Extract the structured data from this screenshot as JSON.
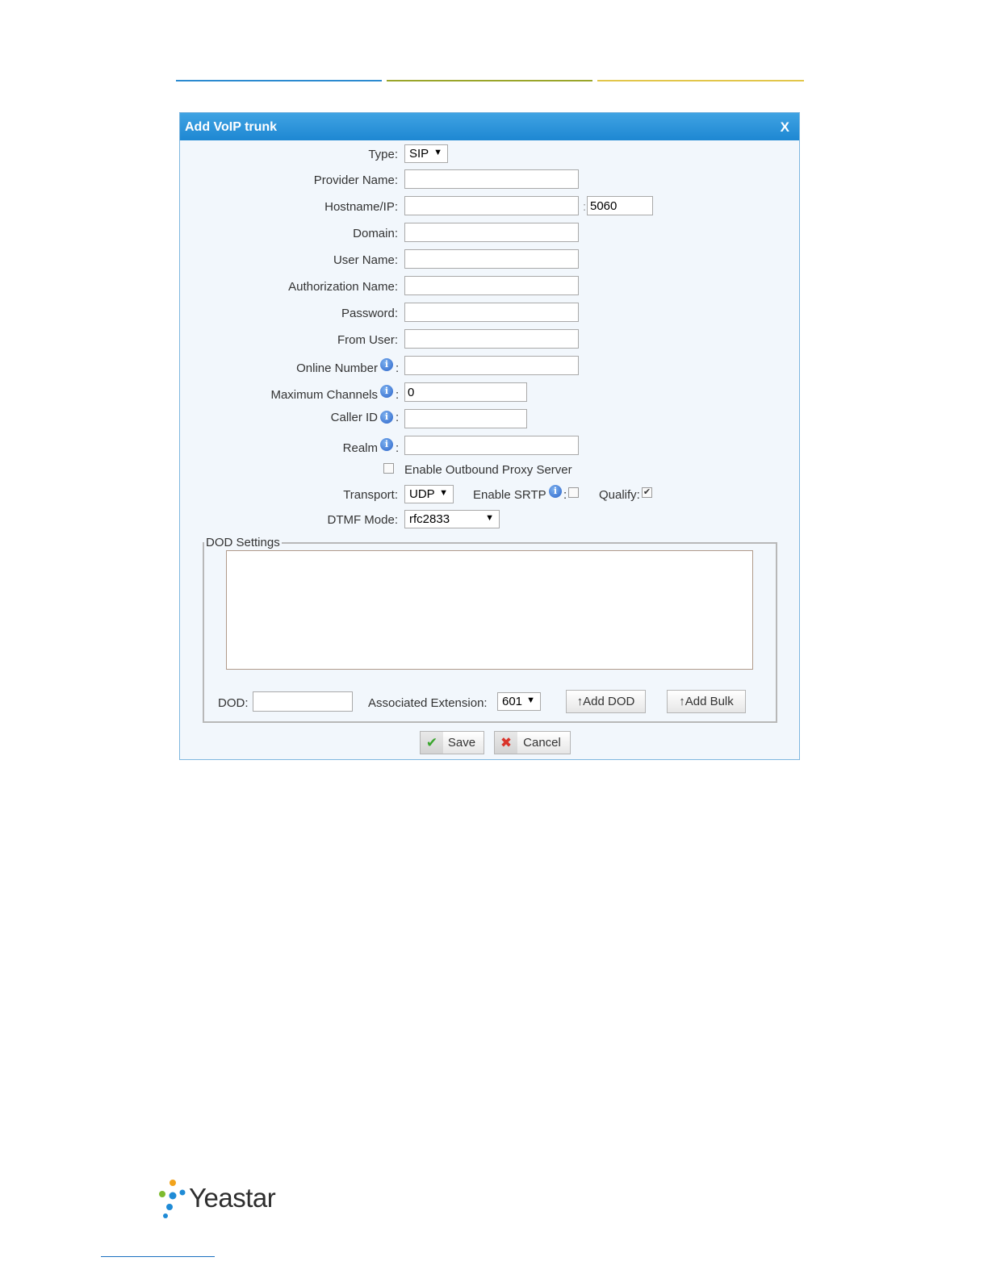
{
  "colors": {
    "title_bar": "#2b95dc",
    "line_blue": "#2b8ad0",
    "line_olive": "#9aa52a",
    "line_gold": "#e2c64a"
  },
  "dialog": {
    "title": "Add VoIP trunk",
    "close": "X"
  },
  "form": {
    "type_label": "Type:",
    "type_value": "SIP",
    "provider_label": "Provider Name:",
    "provider_value": "",
    "hostname_label": "Hostname/IP:",
    "hostname_value": "",
    "port_sep": ":",
    "port_value": "5060",
    "domain_label": "Domain:",
    "domain_value": "",
    "username_label": "User Name:",
    "username_value": "",
    "authname_label": "Authorization Name:",
    "authname_value": "",
    "password_label": "Password:",
    "password_value": "",
    "fromuser_label": "From User:",
    "fromuser_value": "",
    "online_label": "Online Number",
    "online_value": "",
    "maxch_label": "Maximum Channels",
    "maxch_value": "0",
    "callerid_label": "Caller ID",
    "callerid_value": "",
    "realm_label": "Realm",
    "realm_value": "",
    "colon": ":",
    "proxy_label": "Enable Outbound Proxy Server",
    "proxy_checked": false,
    "transport_label": "Transport:",
    "transport_value": "UDP",
    "srtp_label": "Enable SRTP",
    "srtp_checked": false,
    "qualify_label": "Qualify:",
    "qualify_checked": true,
    "dtmf_label": "DTMF Mode:",
    "dtmf_value": "rfc2833"
  },
  "dod": {
    "legend": "DOD Settings",
    "dod_label": "DOD:",
    "dod_value": "",
    "ext_label": "Associated Extension:",
    "ext_value": "601",
    "add_dod": "↑Add DOD",
    "add_bulk": "↑Add Bulk"
  },
  "actions": {
    "save": "Save",
    "cancel": "Cancel"
  },
  "brand": {
    "name": "Yeastar"
  },
  "icons": {
    "info": "info-icon",
    "dropdown": "chevron-down-icon",
    "save": "check-icon",
    "cancel": "x-icon"
  },
  "glyphs": {
    "info": "i",
    "arrow": "▼",
    "check": "✔",
    "cross": "✖"
  }
}
